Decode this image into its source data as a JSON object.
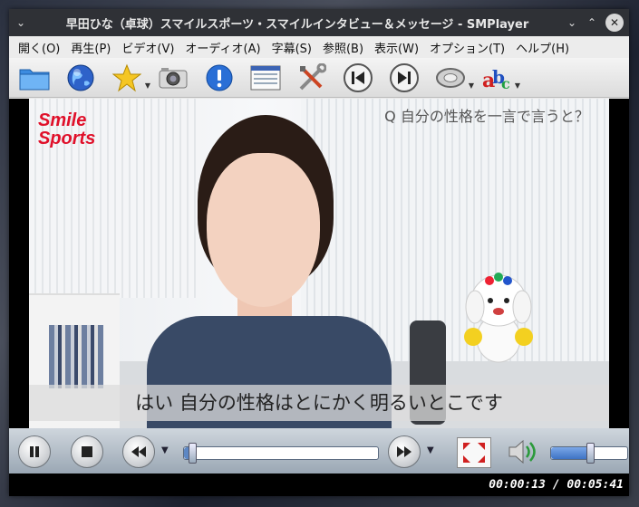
{
  "window": {
    "title": "早田ひな（卓球）スマイルスポーツ・スマイルインタビュー＆メッセージ - SMPlayer"
  },
  "titlebar_buttons": {
    "menu": "⌄",
    "minimize": "⌄",
    "maximize": "⌃",
    "close": "✕"
  },
  "menubar": {
    "items": [
      {
        "label": "開く(O)"
      },
      {
        "label": "再生(P)"
      },
      {
        "label": "ビデオ(V)"
      },
      {
        "label": "オーディオ(A)"
      },
      {
        "label": "字幕(S)"
      },
      {
        "label": "参照(B)"
      },
      {
        "label": "表示(W)"
      },
      {
        "label": "オプション(T)"
      },
      {
        "label": "ヘルプ(H)"
      }
    ]
  },
  "toolbar": {
    "icons": [
      "folder-icon",
      "globe-icon",
      "star-icon",
      "camera-icon",
      "info-icon",
      "playlist-icon",
      "tools-icon",
      "previous-icon",
      "next-icon",
      "audio-track-icon",
      "subtitle-icon"
    ]
  },
  "video": {
    "logo_line1": "Smile",
    "logo_line2": "Sports",
    "question": "Q 自分の性格を一言で言うと？",
    "subtitle": "はい 自分の性格はとにかく明るいとこです"
  },
  "playback": {
    "seek_progress": 0.038,
    "volume_level": 0.5
  },
  "status": {
    "time": "00:00:13 / 00:05:41"
  },
  "colors": {
    "titlebar_bg": "#2f3136",
    "logo_red": "#e0102a",
    "status_bg": "#000000"
  }
}
